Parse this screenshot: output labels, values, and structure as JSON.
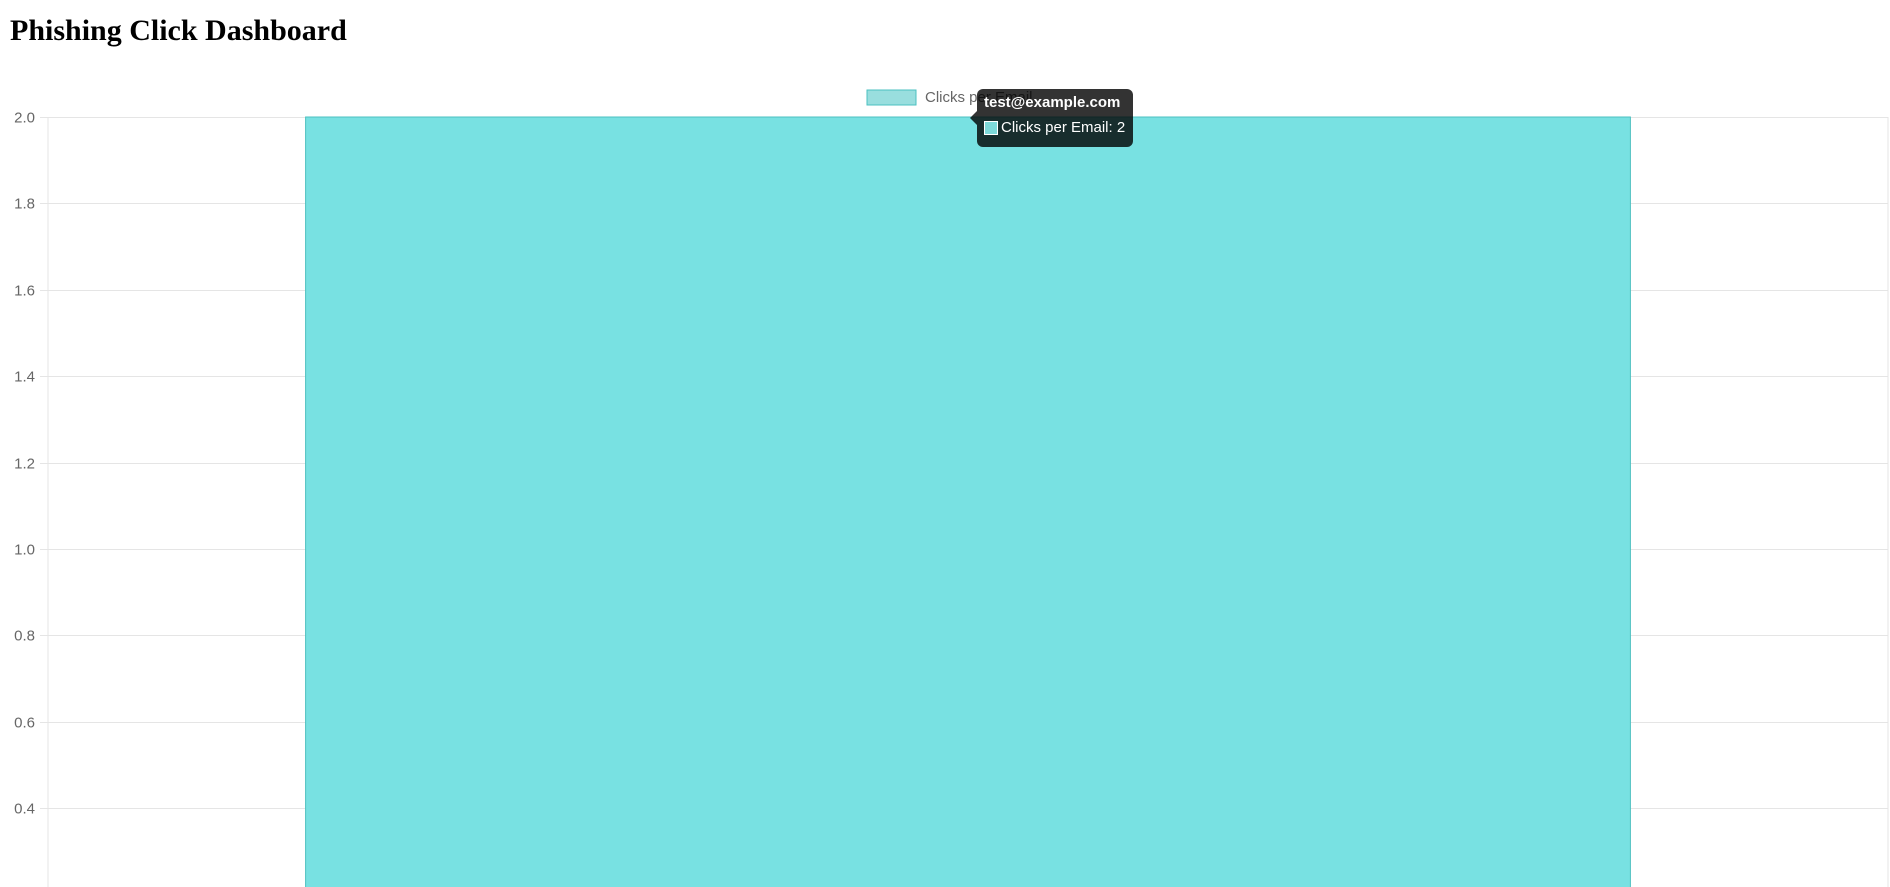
{
  "page": {
    "title": "Phishing Click Dashboard"
  },
  "chart_data": {
    "type": "bar",
    "categories": [
      "test@example.com"
    ],
    "series": [
      {
        "name": "Clicks per Email",
        "values": [
          2
        ],
        "color": "#4bc0c0"
      }
    ],
    "legend": {
      "position": "top",
      "label": "Clicks per Email"
    },
    "ylim": [
      0,
      2.0
    ],
    "y_ticks": [
      "2.0",
      "1.8",
      "1.6",
      "1.4",
      "1.2",
      "1.0",
      "0.8",
      "0.6",
      "0.4"
    ],
    "grid": true,
    "tooltip": {
      "title": "test@example.com",
      "label": "Clicks per Email: 2"
    }
  }
}
